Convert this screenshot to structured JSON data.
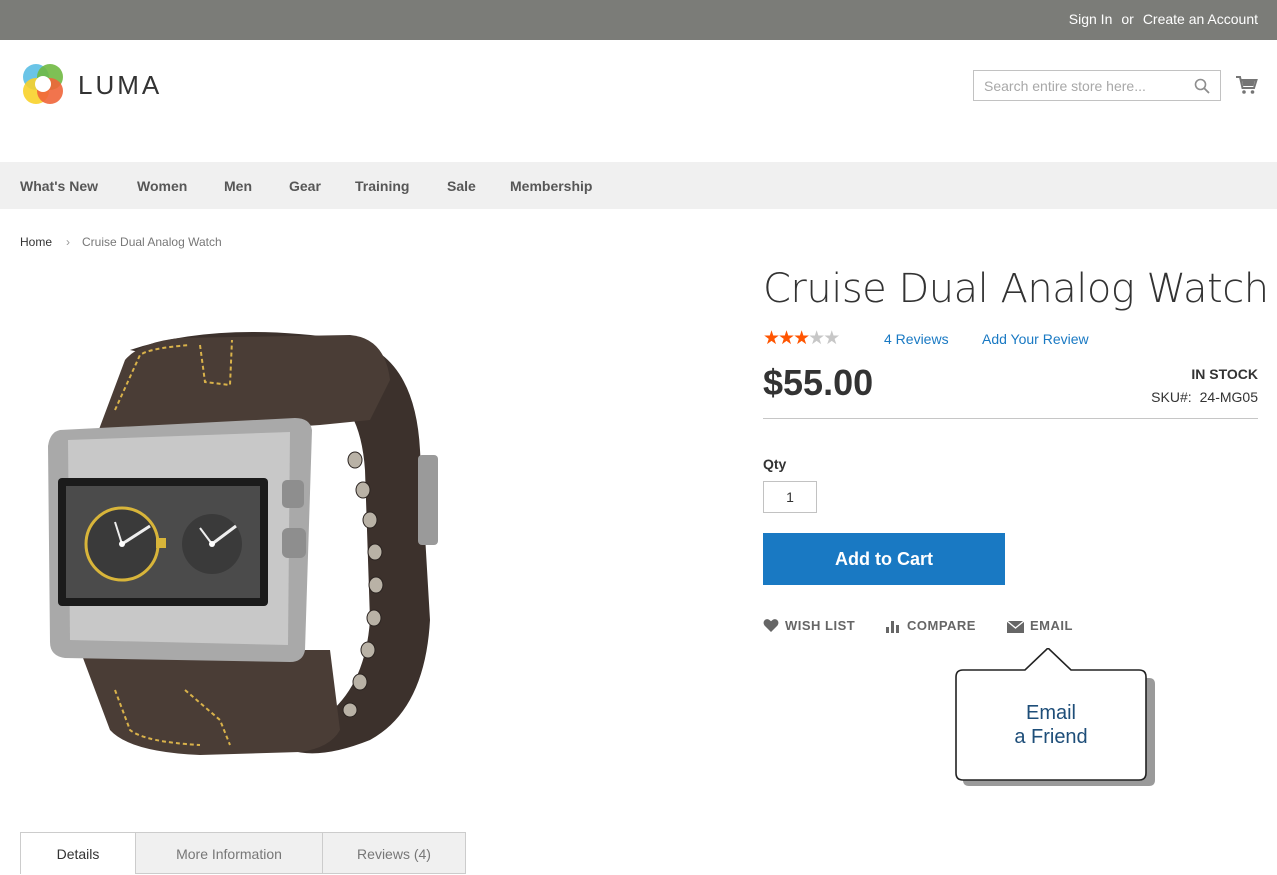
{
  "header": {
    "sign_in": "Sign In",
    "or": "or",
    "create_account": "Create an Account"
  },
  "logo": {
    "text": "LUMA"
  },
  "search": {
    "placeholder": "Search entire store here..."
  },
  "nav": {
    "items": [
      "What's New",
      "Women",
      "Men",
      "Gear",
      "Training",
      "Sale",
      "Membership"
    ]
  },
  "breadcrumb": {
    "home": "Home",
    "separator": "›",
    "current": "Cruise Dual Analog Watch"
  },
  "product": {
    "title": "Cruise Dual Analog Watch",
    "rating_stars_filled": 3,
    "rating_stars_total": 5,
    "reviews_link": "4 Reviews",
    "add_review": "Add Your Review",
    "price": "$55.00",
    "stock": "IN STOCK",
    "sku_label": "SKU#:",
    "sku_value": "24-MG05",
    "qty_label": "Qty",
    "qty_value": "1",
    "add_to_cart": "Add to Cart"
  },
  "actions": {
    "wishlist": "WISH LIST",
    "compare": "COMPARE",
    "email": "EMAIL"
  },
  "tooltip": {
    "line1": "Email",
    "line2": "a Friend"
  },
  "tabs": [
    "Details",
    "More Information",
    "Reviews (4)"
  ],
  "colors": {
    "accent": "#1979c3",
    "star": "#ff5501",
    "star_empty": "#c7c7c7",
    "topbar": "#7b7c78"
  }
}
